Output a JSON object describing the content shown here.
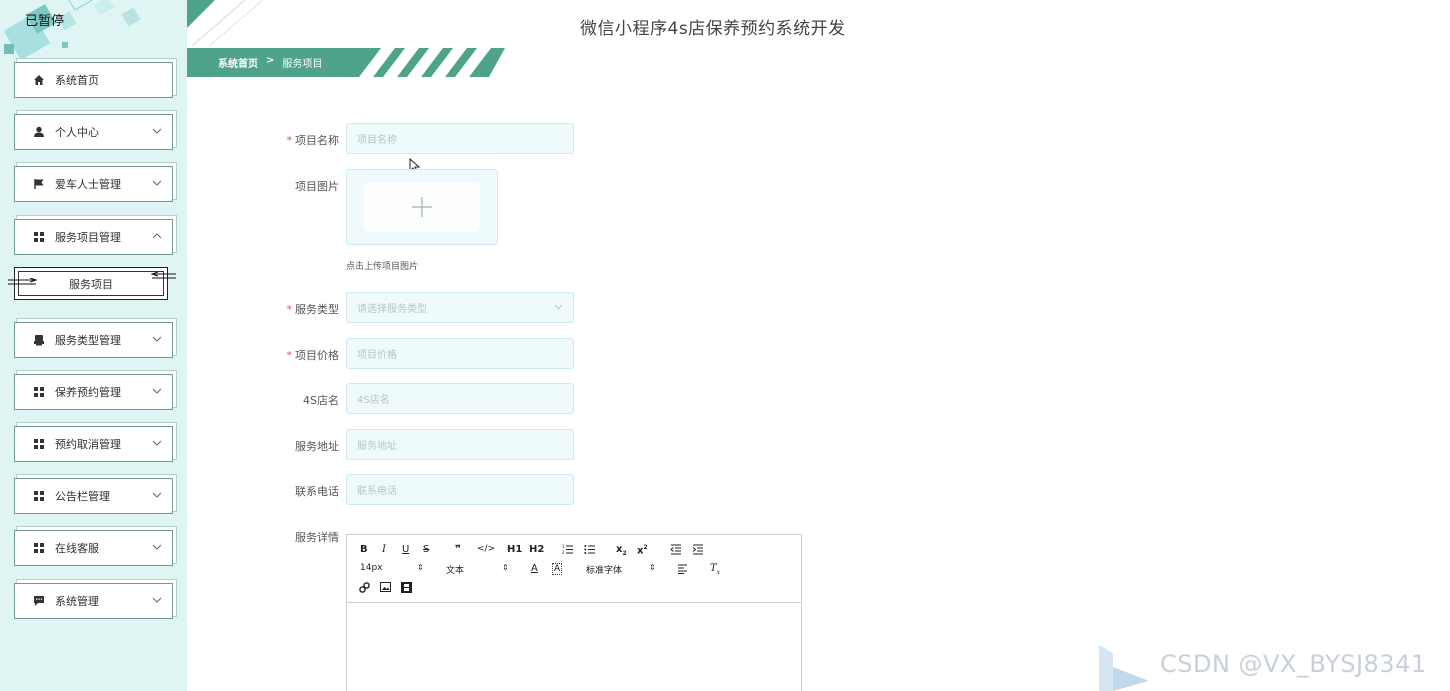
{
  "status_overlay": "已暂停",
  "header": {
    "title": "微信小程序4s店保养预约系统开发"
  },
  "breadcrumb": {
    "home": "系统首页",
    "sep": ">",
    "current": "服务项目"
  },
  "sidebar": {
    "items": [
      {
        "label": "系统首页",
        "icon": "home-icon",
        "has_chevron": false
      },
      {
        "label": "个人中心",
        "icon": "user-icon",
        "has_chevron": true
      },
      {
        "label": "爱车人士管理",
        "icon": "flag-icon",
        "has_chevron": true
      },
      {
        "label": "服务项目管理",
        "icon": "grid-icon",
        "has_chevron": true,
        "expanded": true
      },
      {
        "label": "服务类型管理",
        "icon": "printer-icon",
        "has_chevron": true
      },
      {
        "label": "保养预约管理",
        "icon": "grid-icon",
        "has_chevron": true
      },
      {
        "label": "预约取消管理",
        "icon": "grid-icon",
        "has_chevron": true
      },
      {
        "label": "公告栏管理",
        "icon": "grid-icon",
        "has_chevron": true
      },
      {
        "label": "在线客服",
        "icon": "grid-icon",
        "has_chevron": true
      },
      {
        "label": "系统管理",
        "icon": "chat-icon",
        "has_chevron": true
      }
    ],
    "submenu": {
      "label": "服务项目"
    }
  },
  "form": {
    "name": {
      "label": "项目名称",
      "required": true,
      "placeholder": "项目名称"
    },
    "image": {
      "label": "项目图片",
      "hint": "点击上传项目图片"
    },
    "type": {
      "label": "服务类型",
      "required": true,
      "placeholder": "请选择服务类型"
    },
    "price": {
      "label": "项目价格",
      "required": true,
      "placeholder": "项目价格"
    },
    "shop": {
      "label": "4S店名",
      "placeholder": "4S店名"
    },
    "address": {
      "label": "服务地址",
      "placeholder": "服务地址"
    },
    "phone": {
      "label": "联系电话",
      "placeholder": "联系电话"
    },
    "detail": {
      "label": "服务详情"
    }
  },
  "editor": {
    "font_size": "14px",
    "text_style": "文本",
    "font_family": "标准字体",
    "h1": "H1",
    "h2": "H2"
  },
  "watermark": "CSDN @VX_BYSJ8341",
  "colors": {
    "accent": "#4fa38b",
    "sidebar_bg": "#dff5f4",
    "input_bg": "#eefafb",
    "required": "#e2564a"
  }
}
